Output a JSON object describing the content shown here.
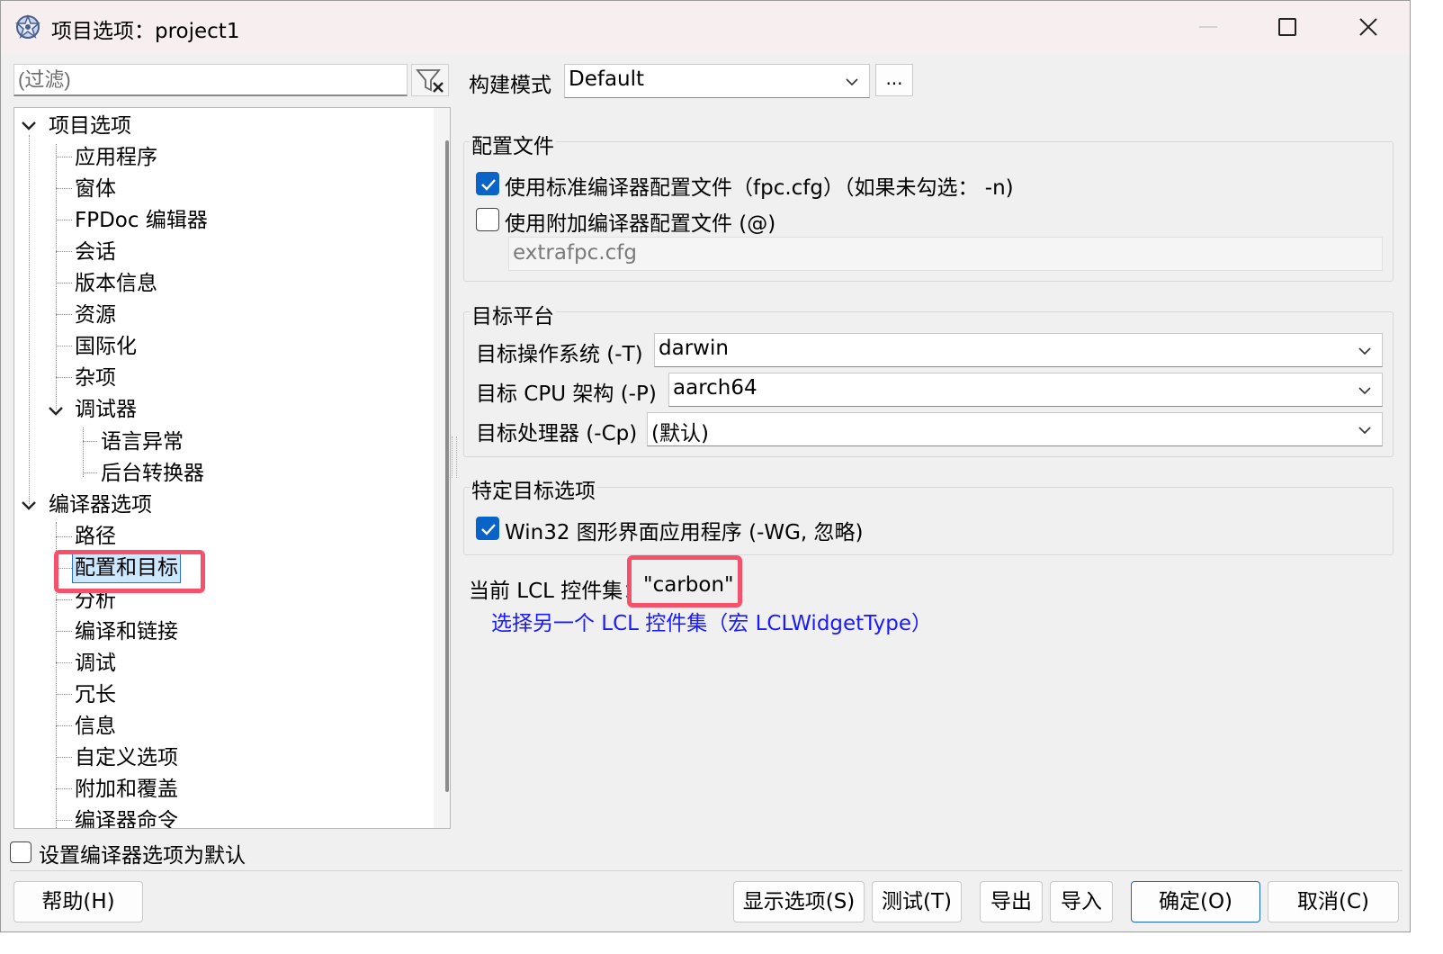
{
  "window": {
    "title": "项目选项：project1"
  },
  "filter": {
    "placeholder": "(过滤)"
  },
  "tree": {
    "items": [
      {
        "label": "项目选项"
      },
      {
        "label": "应用程序"
      },
      {
        "label": "窗体"
      },
      {
        "label": "FPDoc 编辑器"
      },
      {
        "label": "会话"
      },
      {
        "label": "版本信息"
      },
      {
        "label": "资源"
      },
      {
        "label": "国际化"
      },
      {
        "label": "杂项"
      },
      {
        "label": "调试器"
      },
      {
        "label": "语言异常"
      },
      {
        "label": "后台转换器"
      },
      {
        "label": "编译器选项"
      },
      {
        "label": "路径"
      },
      {
        "label": "配置和目标"
      },
      {
        "label": "分析"
      },
      {
        "label": "编译和链接"
      },
      {
        "label": "调试"
      },
      {
        "label": "冗长"
      },
      {
        "label": "信息"
      },
      {
        "label": "自定义选项"
      },
      {
        "label": "附加和覆盖"
      },
      {
        "label": "编译器命令"
      }
    ],
    "selected": "配置和目标"
  },
  "set_default": {
    "label": "设置编译器选项为默认",
    "checked": false
  },
  "build_mode": {
    "label": "构建模式",
    "value": "Default",
    "more_label": "..."
  },
  "config_files": {
    "title": "配置文件",
    "use_standard": {
      "label": "使用标准编译器配置文件（fpc.cfg）（如果未勾选： -n)",
      "checked": true
    },
    "use_additional": {
      "label": "使用附加编译器配置文件 (@)",
      "checked": false
    },
    "additional_file": "extrafpc.cfg"
  },
  "target_platform": {
    "title": "目标平台",
    "os": {
      "label": "目标操作系统 (-T)",
      "value": "darwin"
    },
    "cpu": {
      "label": "目标 CPU 架构 (-P)",
      "value": "aarch64"
    },
    "processor": {
      "label": "目标处理器 (-Cp)",
      "value": "(默认)"
    }
  },
  "target_specific": {
    "title": "特定目标选项",
    "win32_gui": {
      "label": "Win32 图形界面应用程序 (-WG, 忽略)",
      "checked": true
    }
  },
  "lcl": {
    "label": "当前 LCL 控件集：",
    "value": "\"carbon\"",
    "link": "选择另一个 LCL 控件集（宏 LCLWidgetType）"
  },
  "buttons": {
    "help": "帮助(H)",
    "show_options": "显示选项(S)",
    "test": "测试(T)",
    "export": "导出",
    "import": "导入",
    "ok": "确定(O)",
    "cancel": "取消(C)"
  },
  "colors": {
    "highlight": "#f5516b",
    "checkbox": "#0a64c8",
    "link": "#1a1aff"
  }
}
